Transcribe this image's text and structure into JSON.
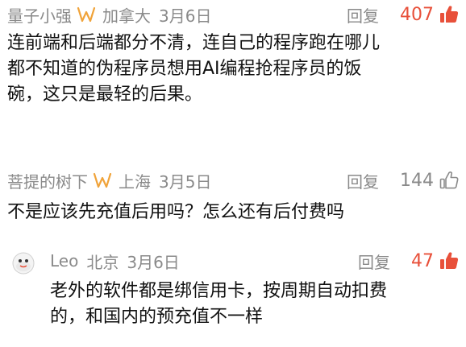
{
  "comments": [
    {
      "username": "量子小强",
      "badge_icon": "vip-badge-icon",
      "location": "加拿大",
      "date": "3月6日",
      "reply_label": "回复",
      "likes": "407",
      "liked": true,
      "text": "连前端和后端都分不清，连自己的程序跑在哪儿\n都不知道的伪程序员想用AI编程抢程序员的饭\n碗，这只是最轻的后果。"
    },
    {
      "username": "菩提的树下",
      "badge_icon": "vip-badge-icon",
      "location": "上海",
      "date": "3月5日",
      "reply_label": "回复",
      "likes": "144",
      "liked": false,
      "text": "不是应该先充值后用吗？怎么还有后付费吗"
    },
    {
      "username": "Leo",
      "location": "北京",
      "date": "3月6日",
      "reply_label": "回复",
      "likes": "47",
      "liked": true,
      "text": "老外的软件都是绑信用卡，按周期自动扣费\n的，和国内的预充值不一样"
    }
  ],
  "colors": {
    "meta_gray": "#8a8a8a",
    "like_active": "#e8503a",
    "badge_orange": "#f0a33a",
    "text": "#111111"
  }
}
